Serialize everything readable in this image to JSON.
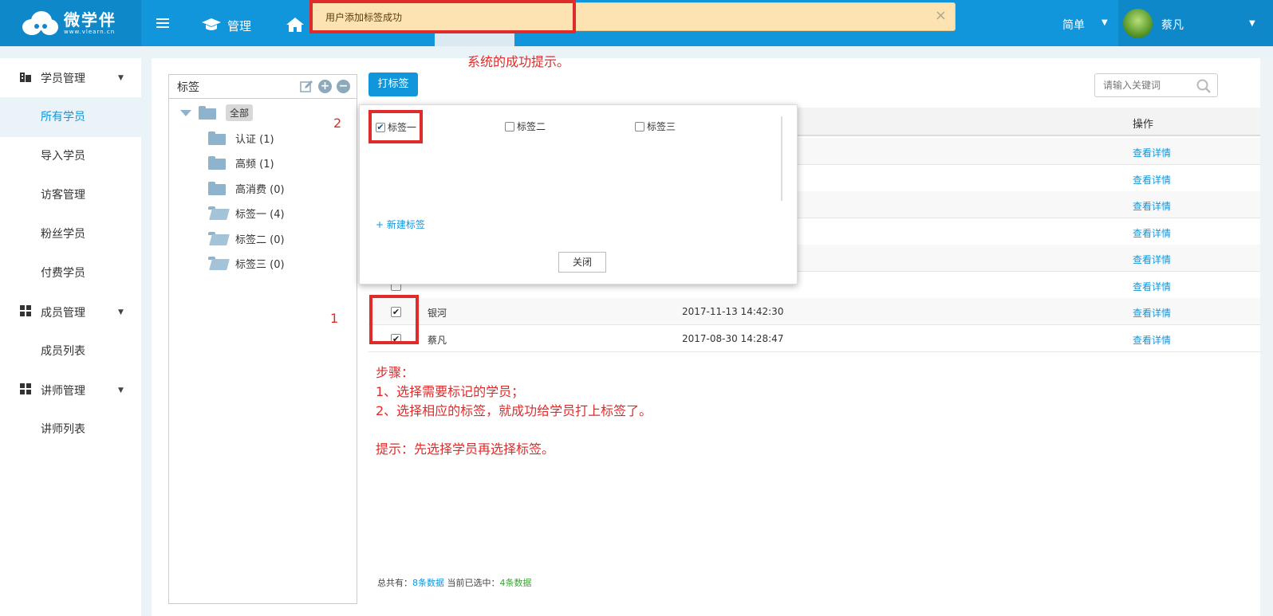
{
  "topbar": {
    "logo_title": "微学伴",
    "logo_sub": "www.vlearn.cn",
    "nav_manage": "管理",
    "toast_text": "用户添加标签成功",
    "toast_close": "×",
    "mode": "简单",
    "user_name": "蔡凡"
  },
  "sidebar": {
    "groups": [
      {
        "label": "学员管理"
      },
      {
        "label": "成员管理"
      },
      {
        "label": "讲师管理"
      }
    ],
    "items": [
      {
        "label": "所有学员"
      },
      {
        "label": "导入学员"
      },
      {
        "label": "访客管理"
      },
      {
        "label": "粉丝学员"
      },
      {
        "label": "付费学员"
      },
      {
        "label": "成员列表"
      },
      {
        "label": "讲师列表"
      }
    ]
  },
  "tags": {
    "title": "标签",
    "all": "全部",
    "items": [
      {
        "label": "认证 (1)"
      },
      {
        "label": "高频 (1)"
      },
      {
        "label": "高消费 (0)"
      },
      {
        "label": "标签一 (4)"
      },
      {
        "label": "标签二 (0)"
      },
      {
        "label": "标签三 (0)"
      }
    ]
  },
  "toolbar": {
    "tag_button": "打标签",
    "search_placeholder": "请输入关键词"
  },
  "table": {
    "op_header": "操作",
    "view_label": "查看详情",
    "rows": [
      {
        "name": "",
        "time": "",
        "checked": false
      },
      {
        "name": "",
        "time": "",
        "checked": false
      },
      {
        "name": "",
        "time": "",
        "checked": false
      },
      {
        "name": "",
        "time": "",
        "checked": false
      },
      {
        "name": "",
        "time": "",
        "checked": false
      },
      {
        "name": "",
        "time": "",
        "checked": false
      },
      {
        "name": "银河",
        "time": "2017-11-13 14:42:30",
        "checked": true
      },
      {
        "name": "蔡凡",
        "time": "2017-08-30 14:28:47",
        "checked": true
      }
    ]
  },
  "popup": {
    "options": [
      {
        "label": "标签一",
        "checked": true
      },
      {
        "label": "标签二",
        "checked": false
      },
      {
        "label": "标签三",
        "checked": false
      }
    ],
    "new_tag": "+ 新建标签",
    "close": "关闭"
  },
  "annotations": {
    "hint_top": "系统的成功提示。",
    "num1": "1",
    "num2": "2",
    "steps_title": "步骤：",
    "step1": "1、选择需要标记的学员；",
    "step2": "2、选择相应的标签，就成功给学员打上标签了。",
    "tip": "提示：先选择学员再选择标签。"
  },
  "footer": {
    "total_label": "总共有：",
    "total_value": "8条数据",
    "selected_label": " 当前已选中：",
    "selected_value": "4条数据"
  },
  "colors": {
    "primary": "#1296db",
    "annotation_red": "#e02b2b",
    "toast_bg": "#fde3b2"
  }
}
